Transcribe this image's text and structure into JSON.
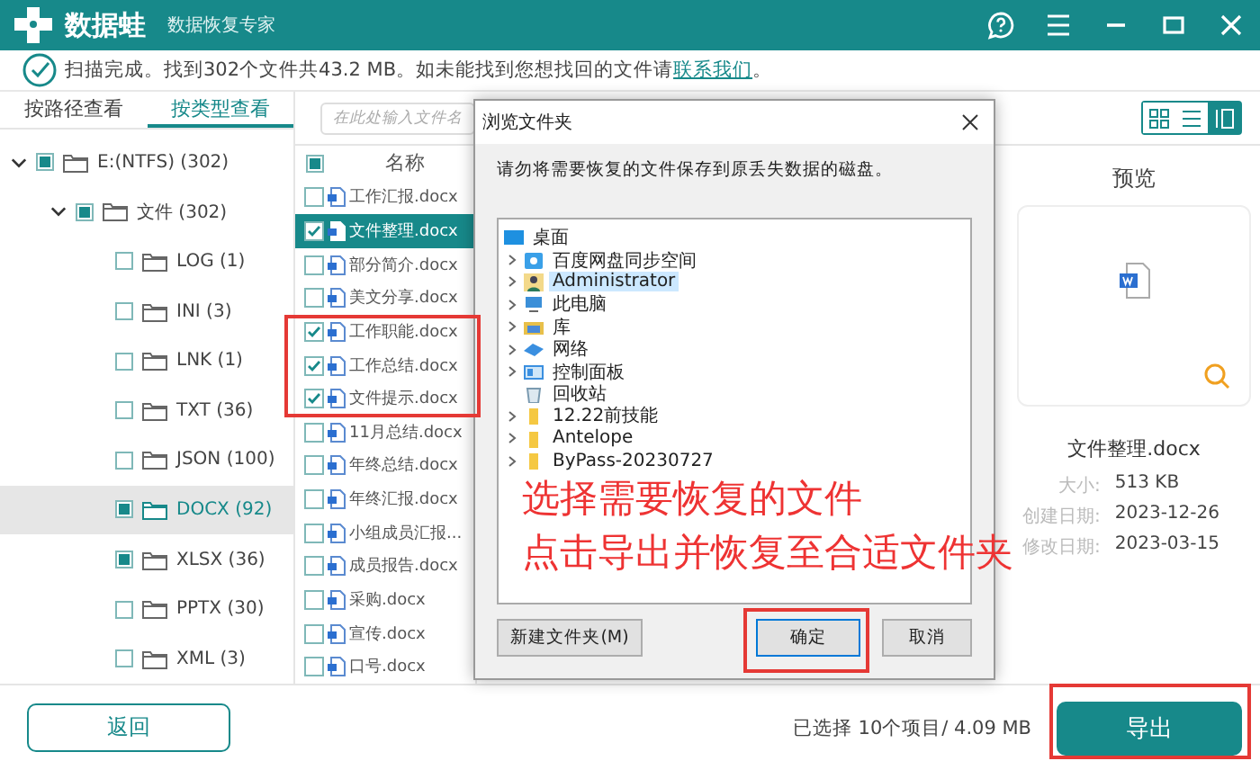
{
  "app": {
    "brand": "数据蛙",
    "subtitle": "数据恢复专家"
  },
  "status": {
    "text": "扫描完成。找到302个文件共43.2 MB。如未能找到您想找回的文件请",
    "link": "联系我们",
    "tail": "。"
  },
  "tabs": [
    {
      "label": "按路径查看",
      "selected": false
    },
    {
      "label": "按类型查看",
      "selected": true
    }
  ],
  "tree": [
    {
      "label": "E:(NTFS) (302)",
      "checked": false,
      "partial": true,
      "selected": false,
      "expanded": true,
      "children": [
        {
          "label": "文件 (302)",
          "checked": false,
          "partial": true,
          "selected": false,
          "expanded": true,
          "children": [
            {
              "label": "LOG (1)",
              "checked": false,
              "partial": false,
              "selected": false
            },
            {
              "label": "INI (3)",
              "checked": false,
              "partial": false,
              "selected": false
            },
            {
              "label": "LNK (1)",
              "checked": false,
              "partial": false,
              "selected": false
            },
            {
              "label": "TXT (36)",
              "checked": false,
              "partial": false,
              "selected": false
            },
            {
              "label": "JSON (100)",
              "checked": false,
              "partial": false,
              "selected": false
            },
            {
              "label": "DOCX (92)",
              "checked": false,
              "partial": true,
              "selected": true
            },
            {
              "label": "XLSX (36)",
              "checked": false,
              "partial": true,
              "selected": false
            },
            {
              "label": "PPTX (30)",
              "checked": false,
              "partial": false,
              "selected": false
            },
            {
              "label": "XML (3)",
              "checked": false,
              "partial": false,
              "selected": false
            }
          ]
        }
      ]
    }
  ],
  "search": {
    "placeholder": "在此处输入文件名"
  },
  "file_list": {
    "header": {
      "label": "名称",
      "partial": true
    },
    "rows": [
      {
        "name": "工作汇报.docx",
        "checked": false,
        "selected": false
      },
      {
        "name": "文件整理.docx",
        "checked": true,
        "selected": true
      },
      {
        "name": "部分简介.docx",
        "checked": false,
        "selected": false
      },
      {
        "name": "美文分享.docx",
        "checked": false,
        "selected": false
      },
      {
        "name": "工作职能.docx",
        "checked": true,
        "selected": false
      },
      {
        "name": "工作总结.docx",
        "checked": true,
        "selected": false
      },
      {
        "name": "文件提示.docx",
        "checked": true,
        "selected": false
      },
      {
        "name": "11月总结.docx",
        "checked": false,
        "selected": false
      },
      {
        "name": "年终总结.docx",
        "checked": false,
        "selected": false
      },
      {
        "name": "年终汇报.docx",
        "checked": false,
        "selected": false
      },
      {
        "name": "小组成员汇报...",
        "checked": false,
        "selected": false
      },
      {
        "name": "成员报告.docx",
        "checked": false,
        "selected": false
      },
      {
        "name": "采购.docx",
        "checked": false,
        "selected": false
      },
      {
        "name": "宣传.docx",
        "checked": false,
        "selected": false
      },
      {
        "name": "口号.docx",
        "checked": false,
        "selected": false
      }
    ]
  },
  "view_modes": [
    {
      "kind": "grid",
      "selected": false
    },
    {
      "kind": "list",
      "selected": false
    },
    {
      "kind": "preview",
      "selected": true
    }
  ],
  "preview": {
    "title": "预览",
    "file_name": "文件整理.docx",
    "details": [
      {
        "label": "大小:",
        "value": "513 KB"
      },
      {
        "label": "创建日期:",
        "value": "2023-12-26"
      },
      {
        "label": "修改日期:",
        "value": "2023-03-15"
      }
    ]
  },
  "dialog": {
    "title": "浏览文件夹",
    "message": "请勿将需要恢复的文件保存到原丢失数据的磁盘。",
    "root": {
      "label": "桌面",
      "kind": "desktop",
      "selected": false,
      "children": [
        {
          "label": "百度网盘同步空间",
          "kind": "cloud",
          "expandable": true,
          "selected": false
        },
        {
          "label": "Administrator",
          "kind": "user",
          "expandable": true,
          "selected": true
        },
        {
          "label": "此电脑",
          "kind": "pc",
          "expandable": true,
          "selected": false
        },
        {
          "label": "库",
          "kind": "library",
          "expandable": true,
          "selected": false
        },
        {
          "label": "网络",
          "kind": "network",
          "expandable": true,
          "selected": false
        },
        {
          "label": "控制面板",
          "kind": "control",
          "expandable": true,
          "selected": false
        },
        {
          "label": "回收站",
          "kind": "recycle",
          "expandable": false,
          "selected": false
        },
        {
          "label": "12.22前技能",
          "kind": "folder",
          "expandable": true,
          "selected": false
        },
        {
          "label": "Antelope",
          "kind": "folder",
          "expandable": true,
          "selected": false
        },
        {
          "label": "ByPass-20230727",
          "kind": "folder",
          "expandable": true,
          "selected": false
        }
      ]
    },
    "buttons": [
      {
        "label": "新建文件夹(M)",
        "kind": "new"
      },
      {
        "label": "确定",
        "kind": "ok"
      },
      {
        "label": "取消",
        "kind": "cancel"
      }
    ]
  },
  "footer": {
    "back": "返回",
    "summary": "已选择 10个项目/ 4.09 MB",
    "export": "导出"
  },
  "annotation": {
    "lines": [
      "选择需要恢复的文件",
      "点击导出并恢复至合适文件夹"
    ]
  }
}
